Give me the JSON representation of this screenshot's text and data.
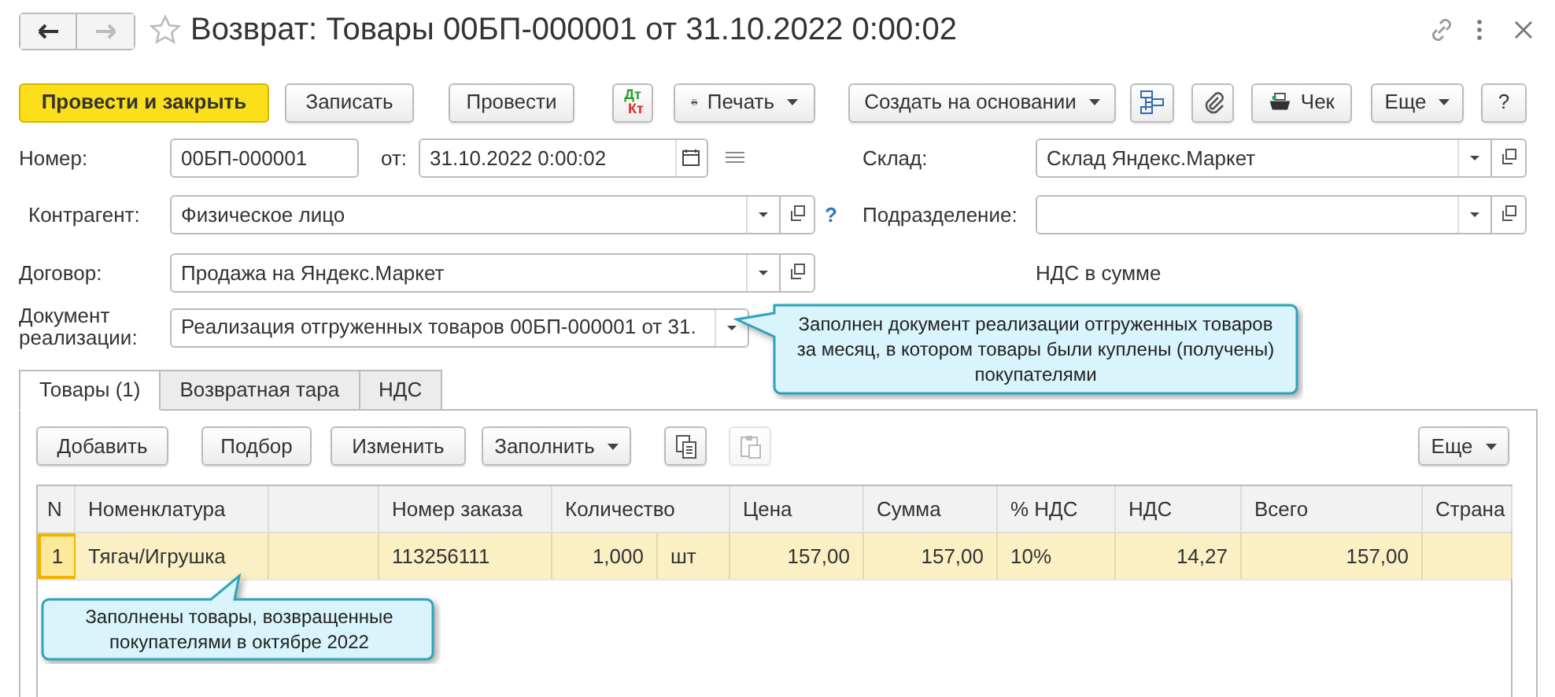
{
  "window": {
    "title": "Возврат: Товары 00БП-000001 от 31.10.2022 0:00:02"
  },
  "toolbar": [
    {
      "kind": "primary",
      "label": "Провести и закрыть"
    },
    {
      "kind": "button",
      "label": "Записать"
    },
    {
      "kind": "button",
      "label": "Провести"
    },
    {
      "kind": "dtkt",
      "top": "Дт",
      "bottom": "Кт"
    },
    {
      "kind": "print",
      "label": "Печать",
      "dropdown": true
    },
    {
      "kind": "button",
      "label": "Создать на основании",
      "dropdown": true
    },
    {
      "kind": "structure"
    },
    {
      "kind": "attach"
    },
    {
      "kind": "receipt",
      "label": "Чек"
    },
    {
      "kind": "button",
      "label": "Еще",
      "dropdown": true
    },
    {
      "kind": "button",
      "label": "?"
    }
  ],
  "number": {
    "label": "Номер:",
    "value": "00БП-000001"
  },
  "date": {
    "label": "от:",
    "value": "31.10.2022  0:00:02"
  },
  "warehouse": {
    "label": "Склад:",
    "value": "Склад Яндекс.Маркет"
  },
  "counterparty": {
    "label": "Контрагент:",
    "value": "Физическое лицо",
    "help": "?"
  },
  "department": {
    "label": "Подразделение:"
  },
  "contract": {
    "label": "Договор:",
    "value": "Продажа на Яндекс.Маркет"
  },
  "vat_note": "НДС в сумме",
  "sales_document": {
    "label": "Документ реализации:",
    "value": "Реализация отгруженных товаров 00БП-000001 от 31."
  },
  "callouts": [
    {
      "text": "Заполнен документ реализации отгруженных товаров за месяц, в котором товары были куплены (получены) покупателями"
    },
    {
      "text": "Заполнены товары, возвращенные покупателями в октябре 2022"
    }
  ],
  "tabs": [
    {
      "label": "Товары (1)",
      "selected": true
    },
    {
      "label": "Возвратная тара",
      "selected": false
    },
    {
      "label": "НДС",
      "selected": false
    }
  ],
  "table_toolbar": [
    {
      "kind": "button",
      "label": "Добавить",
      "dropdown": false,
      "disabled": false
    },
    {
      "kind": "button",
      "label": "Подбор",
      "dropdown": false,
      "disabled": false
    },
    {
      "kind": "button",
      "label": "Изменить",
      "dropdown": false,
      "disabled": false
    },
    {
      "kind": "button",
      "label": "Заполнить",
      "dropdown": true,
      "disabled": false
    },
    {
      "kind": "copy",
      "disabled": false
    },
    {
      "kind": "paste",
      "disabled": true
    },
    {
      "kind": "button",
      "label": "Еще",
      "dropdown": true,
      "disabled": false
    }
  ],
  "table": {
    "columns": [
      {
        "kind": "heading",
        "label": "N"
      },
      {
        "kind": "heading",
        "label": "Номенклатура"
      },
      {
        "kind": "spacer"
      },
      {
        "kind": "heading",
        "label": "Номер заказа"
      },
      {
        "kind": "heading",
        "label": "Количество"
      },
      {
        "kind": "heading",
        "label": "Цена"
      },
      {
        "kind": "heading",
        "label": "Сумма"
      },
      {
        "kind": "heading",
        "label": "% НДС"
      },
      {
        "kind": "heading",
        "label": "НДС"
      },
      {
        "kind": "heading",
        "label": "Всего"
      },
      {
        "kind": "heading",
        "label": "Страна"
      }
    ],
    "rows": [
      {
        "selected": true,
        "n": "1",
        "item": "Тягач/Игрушка",
        "order": "113256111",
        "quantity": "1,000",
        "unit": "шт",
        "price": "157,00",
        "sum": "157,00",
        "vat_rate": "10%",
        "vat": "14,27",
        "total": "157,00"
      }
    ]
  }
}
